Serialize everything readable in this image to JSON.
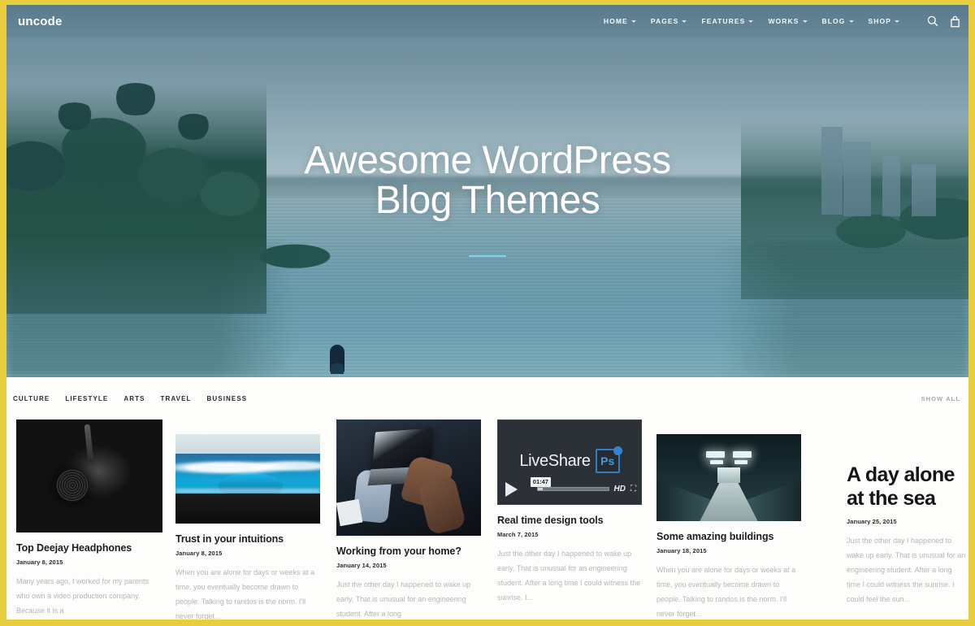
{
  "theme": {
    "frame_color": "#e8ce3e",
    "accent_color": "#7fd4e8",
    "page_background": "#fdfdfb"
  },
  "header": {
    "logo": "uncode",
    "nav": [
      {
        "label": "HOME",
        "has_dropdown": true
      },
      {
        "label": "PAGES",
        "has_dropdown": true
      },
      {
        "label": "FEATURES",
        "has_dropdown": true
      },
      {
        "label": "WORKS",
        "has_dropdown": true
      },
      {
        "label": "BLOG",
        "has_dropdown": true
      },
      {
        "label": "SHOP",
        "has_dropdown": true
      }
    ],
    "tools": [
      {
        "icon": "search-icon"
      },
      {
        "icon": "cart-icon"
      }
    ]
  },
  "hero": {
    "title_line1": "Awesome WordPress",
    "title_line2": "Blog Themes"
  },
  "filterbar": {
    "filters": [
      "CULTURE",
      "LIFESTYLE",
      "ARTS",
      "TRAVEL",
      "BUSINESS"
    ],
    "show_all": "SHOW ALL"
  },
  "posts": [
    {
      "title": "Top Deejay Headphones",
      "date": "January 8, 2015",
      "excerpt": "Many years ago, I worked for my parents who own a video production company. Because it is a",
      "media": "headphones-image"
    },
    {
      "title": "Trust in your intuitions",
      "date": "January 8, 2015",
      "excerpt": "When you are alone for days or weeks at a time, you eventually become drawn to people. Talking to randos is the norm. I'll never forget...",
      "media": "ocean-wave-image"
    },
    {
      "title": "Working from your home?",
      "date": "January 14, 2015",
      "excerpt": "Just the other day I happened to wake up early. That is unusual for an engineering student. After a long",
      "media": "laptop-image"
    },
    {
      "title": "Real time design tools",
      "date": "March 7, 2015",
      "excerpt": "Just the other day I happened to wake up early. That is unusual for an engineering student. After a long time I could witness the sunrise. I...",
      "media": "video-thumbnail",
      "video": {
        "logo_text": "LiveShare",
        "app_badge": "Ps",
        "timestamp": "01:47",
        "quality": "HD"
      }
    },
    {
      "title": "Some amazing buildings",
      "date": "January 18, 2015",
      "excerpt": "When you are alone for days or weeks at a time, you eventually become drawn to people. Talking to randos is the norm. I'll never forget...",
      "media": "corridor-image"
    },
    {
      "title": "A day alone at the sea",
      "date": "January 25, 2015",
      "excerpt": "Just the other day I happened to wake up early. That is unusual for an engineering student. After a long time I could witness the sunrise. I could feel the sun...",
      "media": "none"
    }
  ]
}
